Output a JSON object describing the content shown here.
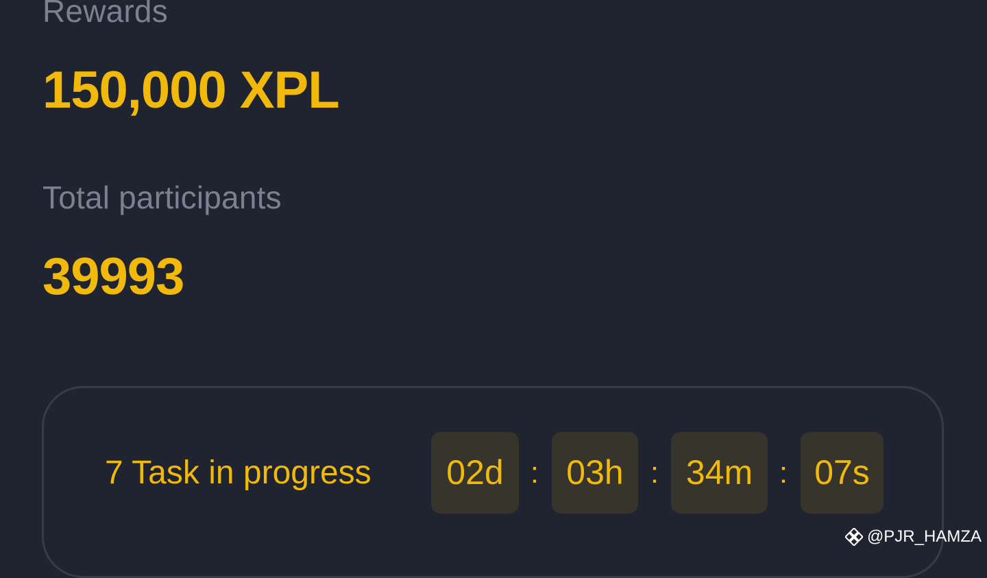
{
  "stats": {
    "rewards_label": "Rewards",
    "rewards_value": "150,000 XPL",
    "participants_label": "Total participants",
    "participants_value": "39993"
  },
  "task": {
    "label": "7 Task in progress",
    "countdown": {
      "days": "02d",
      "hours": "03h",
      "minutes": "34m",
      "seconds": "07s",
      "separator": ":"
    }
  },
  "watermark": {
    "icon": "binance-logo-icon",
    "handle": "@PJR_HAMZA"
  },
  "colors": {
    "background": "#1f2430",
    "accent": "#f0b90b",
    "muted_text": "#7a8291",
    "time_box": "#36342b",
    "card_border": "#363c49"
  }
}
